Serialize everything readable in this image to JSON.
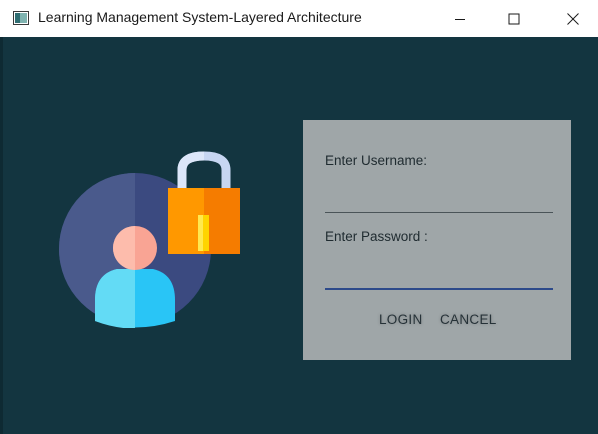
{
  "window": {
    "title": "Learning Management System-Layered Architecture"
  },
  "illustration": {
    "icon": "user-lock-icon"
  },
  "login": {
    "username_label": "Enter Username:",
    "username_value": "",
    "password_label": "Enter Password :",
    "password_value": "",
    "login_label": "LOGIN",
    "cancel_label": "CANCEL"
  },
  "colors": {
    "background": "#133540",
    "panel": "#9fa6a8",
    "password_underline": "#2d4a8a",
    "lock_body": "#ff9800",
    "avatar_circle": "#3b4a80"
  }
}
